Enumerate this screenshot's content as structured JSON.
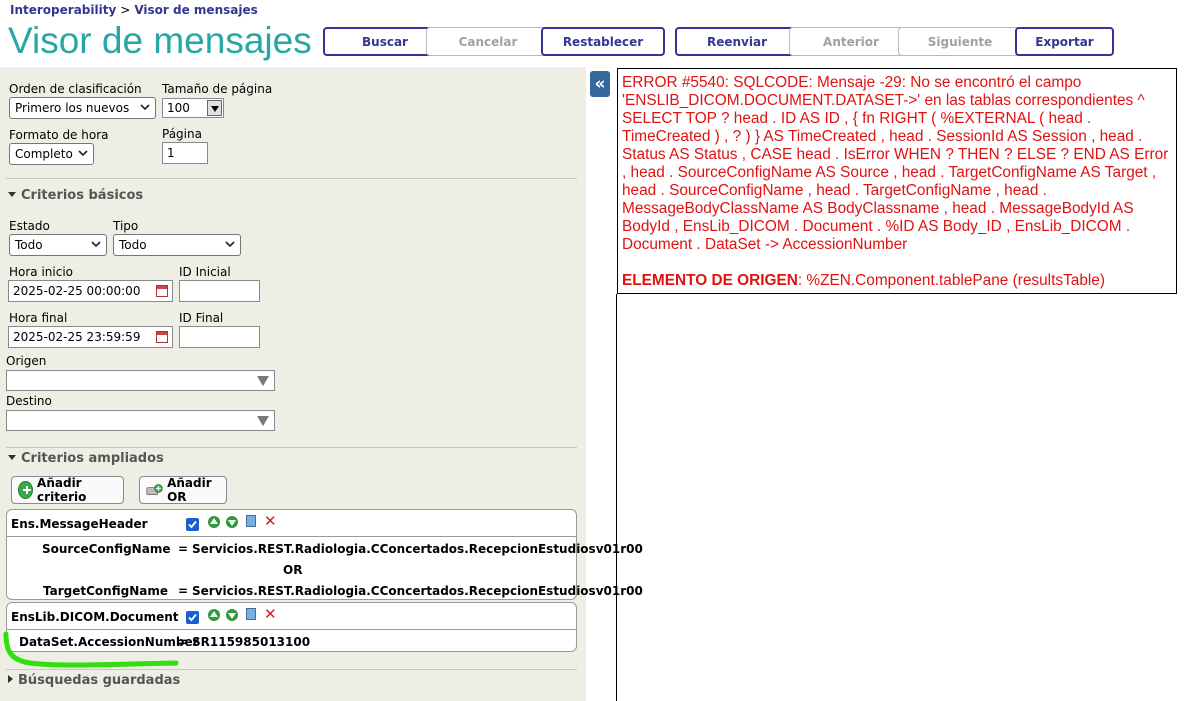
{
  "breadcrumb": {
    "root": "Interoperability",
    "separator": ">",
    "current": "Visor de mensajes"
  },
  "title": "Visor de mensajes",
  "toolbar": {
    "buscar": "Buscar",
    "cancelar": "Cancelar",
    "restablecer": "Restablecer",
    "reenviar": "Reenviar",
    "anterior": "Anterior",
    "siguiente": "Siguiente",
    "exportar": "Exportar"
  },
  "options": {
    "sort_label": "Orden de clasificación",
    "sort_value": "Primero los nuevos",
    "page_size_label": "Tamaño de página",
    "page_size_value": "100",
    "time_format_label": "Formato de hora",
    "time_format_value": "Completo",
    "page_label": "Página",
    "page_value": "1"
  },
  "basic": {
    "header": "Criterios básicos",
    "estado_label": "Estado",
    "estado_value": "Todo",
    "tipo_label": "Tipo",
    "tipo_value": "Todo",
    "start_label": "Hora inicio",
    "start_value": "2025-02-25 00:00:00",
    "start_id_label": "ID Inicial",
    "start_id_value": "",
    "end_label": "Hora final",
    "end_value": "2025-02-25 23:59:59",
    "end_id_label": "ID Final",
    "end_id_value": "",
    "origen_label": "Origen",
    "destino_label": "Destino"
  },
  "extended": {
    "header": "Criterios ampliados",
    "add_criterion": "Añadir criterio",
    "add_or": "Añadir OR",
    "box1": {
      "title": "Ens.MessageHeader",
      "row1_field": "SourceConfigName",
      "row1_op": "=",
      "row1_value": "Servicios.REST.Radiologia.CConcertados.RecepcionEstudiosv01r00",
      "or_label": "OR",
      "row2_field": "TargetConfigName",
      "row2_op": "=",
      "row2_value": "Servicios.REST.Radiologia.CConcertados.RecepcionEstudiosv01r00"
    },
    "box2": {
      "title": "EnsLib.DICOM.Document",
      "row1_field": "DataSet.AccessionNumber",
      "row1_op": "=",
      "row1_value": "SR115985013100"
    }
  },
  "saved": {
    "header": "Búsquedas guardadas"
  },
  "collapse_glyph": "«",
  "error": {
    "message": "ERROR #5540: SQLCODE: Mensaje -29: No se encontró el campo 'ENSLIB_DICOM.DOCUMENT.DATASET->' en las tablas correspondientes ^ SELECT TOP ? head . ID AS ID , { fn RIGHT ( %EXTERNAL ( head . TimeCreated ) , ? ) } AS TimeCreated , head . SessionId AS Session , head . Status AS Status , CASE head . IsError WHEN ? THEN ? ELSE ? END AS Error , head . SourceConfigName AS Source , head . TargetConfigName AS Target , head . SourceConfigName , head . TargetConfigName , head . MessageBodyClassName AS BodyClassname , head . MessageBodyId AS BodyId , EnsLib_DICOM . Document . %ID AS Body_ID , EnsLib_DICOM . Document . DataSet -> AccessionNumber",
    "origin_label": "ELEMENTO DE ORIGEN",
    "origin_value": ": %ZEN.Component.tablePane (resultsTable)"
  },
  "colors": {
    "accent": "#333695",
    "title": "#28a6a6",
    "error": "#e01212",
    "highlight": "#33dd11"
  }
}
